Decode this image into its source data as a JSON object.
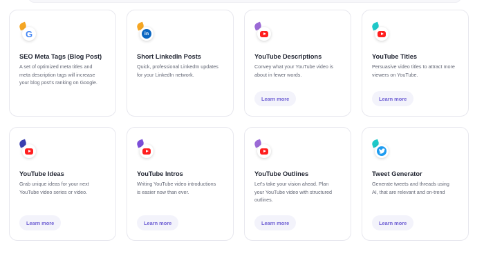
{
  "cards": [
    {
      "title": "SEO Meta Tags (Blog Post)",
      "desc": "A set of optimized meta titles and meta description tags will increase your blog post's ranking on Google.",
      "icon": "google-icon",
      "dot_color": "#f5a623"
    },
    {
      "title": "Short LinkedIn Posts",
      "desc": "Quick, professional LinkedIn updates for your LinkedIn network.",
      "icon": "linkedin-icon",
      "dot_color": "#f5a623"
    },
    {
      "title": "YouTube Descriptions",
      "desc": "Convey what your YouTube video is about in fewer words.",
      "icon": "youtube-icon",
      "dot_color": "#9b6ad6",
      "button": "Learn more"
    },
    {
      "title": "YouTube Titles",
      "desc": "Persuasive video titles to attract more viewers on YouTube.",
      "icon": "youtube-icon",
      "dot_color": "#1ec8c8",
      "button": "Learn more"
    },
    {
      "title": "YouTube Ideas",
      "desc": "Grab unique ideas for your next YouTube video series or video.",
      "icon": "youtube-icon",
      "dot_color": "#3a3fb0",
      "button": "Learn more"
    },
    {
      "title": "YouTube Intros",
      "desc": "Writing YouTube video introductions is easier now than ever.",
      "icon": "youtube-icon",
      "dot_color": "#7b4ed8",
      "button": "Learn more"
    },
    {
      "title": "YouTube Outlines",
      "desc": "Let's take your vision ahead. Plan your YouTube video with structured outlines.",
      "icon": "youtube-icon",
      "dot_color": "#9b6ad6",
      "button": "Learn more"
    },
    {
      "title": "Tweet Generator",
      "desc": "Generate tweets  and threads using AI, that are relevant and on-trend",
      "icon": "twitter-icon",
      "dot_color": "#1ec8c8",
      "button": "Learn more"
    }
  ],
  "colors": {
    "accent": "#6e5fd3",
    "button_bg": "#f3f3fb",
    "border": "#e7e7ee"
  }
}
